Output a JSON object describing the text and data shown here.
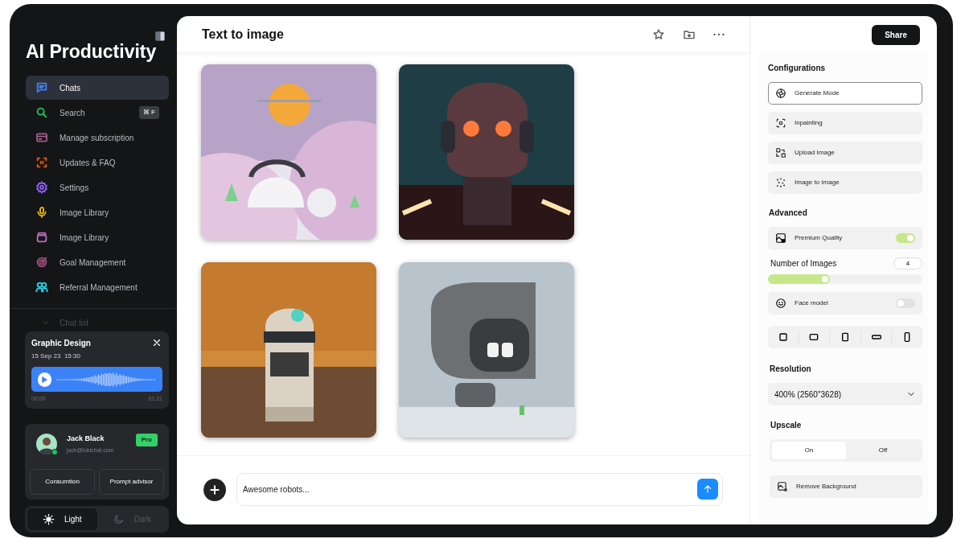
{
  "sidebar": {
    "title": "AI Productivity",
    "nav": [
      {
        "label": "Chats",
        "kind": "chat",
        "color": "#3b82f6",
        "selected": true
      },
      {
        "label": "Search",
        "kind": "search",
        "color": "#22c55e",
        "selected": false,
        "shortcut": "⌘ F"
      },
      {
        "label": "Manage subscription",
        "kind": "card",
        "color": "#a05a8a",
        "selected": false
      },
      {
        "label": "Updates & FAQ",
        "kind": "scan",
        "color": "#ea580c",
        "selected": false
      },
      {
        "label": "Settings",
        "kind": "gear",
        "color": "#8b5cf6",
        "selected": false
      },
      {
        "label": "Image Library",
        "kind": "mic",
        "color": "#eab308",
        "selected": false
      },
      {
        "label": "Image Library",
        "kind": "jar",
        "color": "#c06cc0",
        "selected": false
      },
      {
        "label": "Goal Management",
        "kind": "target",
        "color": "#9d4e7a",
        "selected": false
      },
      {
        "label": "Referral Management",
        "kind": "people",
        "color": "#22d3ee",
        "selected": false
      }
    ],
    "chat_list": {
      "label": "Chat list"
    },
    "audio_card": {
      "title": "Graphic Design",
      "date": "15 Sep 23  15:30",
      "start": "00:00",
      "end": "01:21"
    },
    "profile": {
      "name": "Jack Black",
      "email": "jack@lokichat.com",
      "badge": "Pro",
      "online": true,
      "buttons": [
        "Consumtion",
        "Prompt advisor"
      ]
    },
    "theme": [
      {
        "label": "Light",
        "kind": "sun",
        "selected": true
      },
      {
        "label": "Dark",
        "kind": "moon",
        "selected": false
      }
    ]
  },
  "main": {
    "title": "Text to image",
    "prompt": {
      "value": "Awesome robots..."
    }
  },
  "panel": {
    "share": "Share",
    "configurations": {
      "heading": "Configurations",
      "modes": [
        {
          "label": "Generate Mode",
          "kind": "aperture",
          "selected": true
        },
        {
          "label": "Inpainting",
          "kind": "inpaint",
          "selected": false
        },
        {
          "label": "Upload Image",
          "kind": "swap",
          "selected": false
        },
        {
          "label": "Image to Image",
          "kind": "dots",
          "selected": false
        }
      ]
    },
    "advanced": {
      "heading": "Advanced",
      "premium": {
        "label": "Premium Quality",
        "on": true
      },
      "images_count": {
        "label": "Number of Images",
        "value": "4",
        "level": 0.4
      },
      "face": {
        "label": "Face model",
        "on": false
      },
      "ratios": [
        {
          "kind": "square"
        },
        {
          "kind": "landscape"
        },
        {
          "kind": "portrait"
        },
        {
          "kind": "wide"
        },
        {
          "kind": "tall"
        }
      ]
    },
    "resolution": {
      "heading": "Resolution",
      "value": "400% (2560\"3628)"
    },
    "upscale": {
      "heading": "Upscale",
      "options": [
        {
          "label": "On",
          "selected": true
        },
        {
          "label": "Off",
          "selected": false
        }
      ]
    },
    "remove_bg": {
      "label": "Remove Background"
    }
  }
}
